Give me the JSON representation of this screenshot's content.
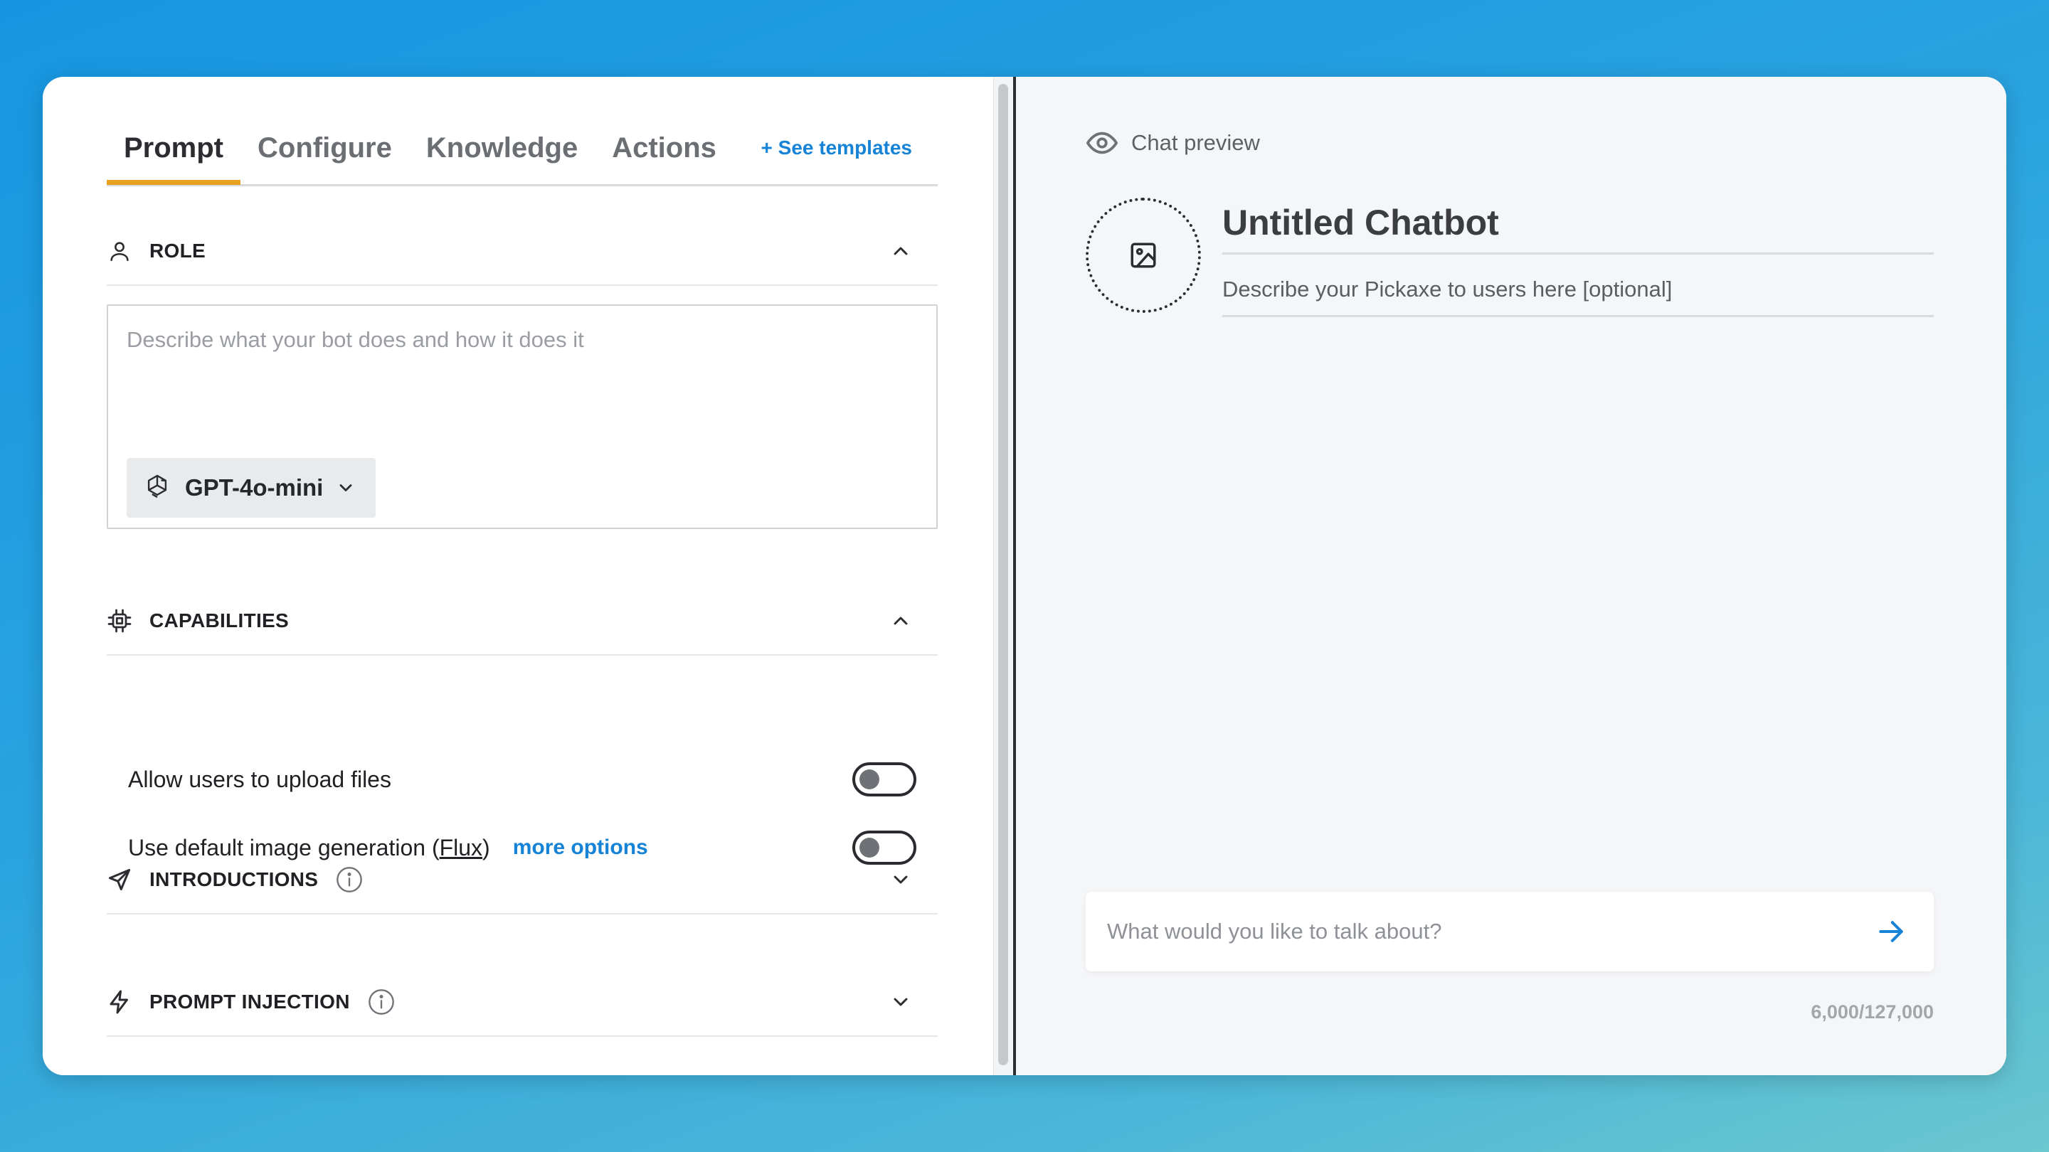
{
  "tabs": [
    {
      "label": "Prompt",
      "active": true
    },
    {
      "label": "Configure",
      "active": false
    },
    {
      "label": "Knowledge",
      "active": false
    },
    {
      "label": "Actions",
      "active": false
    }
  ],
  "templates_link": "+ See templates",
  "sections": {
    "role": {
      "title": "ROLE",
      "icon": "user-icon",
      "expanded": true
    },
    "capabilities": {
      "title": "CAPABILITIES",
      "icon": "chip-icon",
      "expanded": true
    },
    "introductions": {
      "title": "INTRODUCTIONS",
      "icon": "send-arrow-icon",
      "expanded": false
    },
    "prompt_injection": {
      "title": "PROMPT INJECTION",
      "icon": "lightning-icon",
      "expanded": false
    }
  },
  "role": {
    "placeholder": "Describe what your bot does and how it does it",
    "model": "GPT-4o-mini"
  },
  "capabilities": {
    "upload_label": "Allow users to upload files",
    "image_gen_label_prefix": "Use default image generation (",
    "image_gen_link": "Flux",
    "image_gen_label_suffix": ")",
    "more_options": "more options",
    "upload_enabled": false,
    "image_gen_enabled": false
  },
  "preview": {
    "label": "Chat preview",
    "bot_name": "Untitled Chatbot",
    "bot_description": "Describe your Pickaxe to users here [optional]",
    "input_placeholder": "What would you like to talk about?",
    "counter": "6,000/127,000"
  },
  "colors": {
    "accent": "#e8a21f",
    "link": "#1683d6",
    "background_gradient_start": "#1696e2",
    "background_gradient_end": "#6cc7cf"
  }
}
